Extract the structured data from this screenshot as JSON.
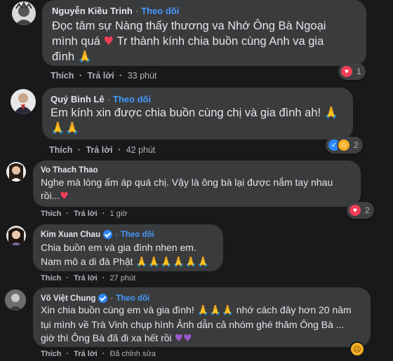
{
  "follow_label": "Theo dõi",
  "separator": "·",
  "action_like": "Thích",
  "action_reply": "Trả lời",
  "comments": [
    {
      "name": "Nguyễn Kiều Trinh",
      "verified": false,
      "lines": [
        "Đọc tâm sự Nàng thấy thương va Nhớ Ông Bà Ngoại",
        "mình quá",
        "Tr thành kính chia buồn cùng Anh va gia",
        "đình"
      ],
      "time": "33 phút",
      "reaction_count": "1",
      "reaction_icons": [
        "love-icon"
      ]
    },
    {
      "name": "Quý Bình Lê",
      "verified": false,
      "lines": [
        "Em kính xin được chia buồn cùng chị và gia đình ah!"
      ],
      "time": "42 phút",
      "reaction_count": "2",
      "reaction_icons": [
        "like-icon",
        "care-icon"
      ]
    },
    {
      "name": "Vo Thach Thao",
      "verified": false,
      "lines": [
        "Nghe mà lòng ấm áp quá chị. Vậy là ông bà lại được nắm tay nhau",
        "rồi..."
      ],
      "time": "1 giờ",
      "reaction_count": "2",
      "reaction_icons": [
        "love-icon"
      ]
    },
    {
      "name": "Kim Xuan Chau",
      "verified": true,
      "lines": [
        "Chia buồn em và gia đình nhen em.",
        "Nam mô a di đà Phật"
      ],
      "time": "27 phút"
    },
    {
      "name": "Võ Việt Chung",
      "verified": true,
      "lines": [
        "Xin chia buồn cùng em và gia đình!",
        "nhớ cách đây hơn 20 năm",
        "tụi mình về Trà Vinh chụp hình Ảnh dẫn cả nhóm ghé thăm Ông Bà ...",
        "giờ thì Ông Bà đã đi xa hết rồi"
      ],
      "time": "Đã chỉnh sửa"
    }
  ],
  "emoji": {
    "pray": "🙏",
    "heart": "♥",
    "purple_heart": "♥",
    "sad": "☹",
    "like": "👍"
  },
  "colors": {
    "background": "#18191a",
    "bubble": "#3a3b3c",
    "link": "#4599ff",
    "text": "#e4e6eb",
    "secondary": "#b0b3b8"
  }
}
